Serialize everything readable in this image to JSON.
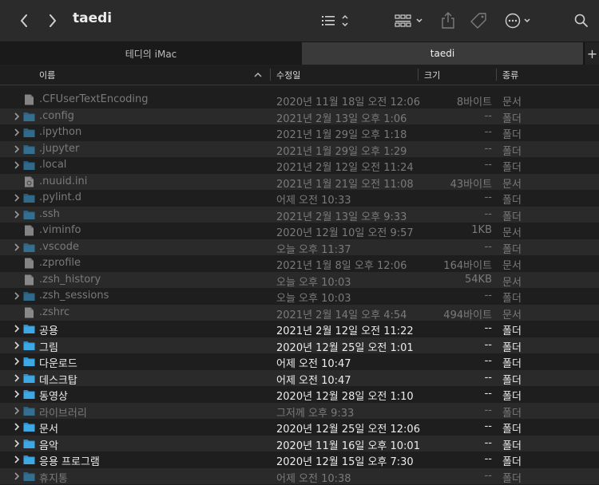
{
  "window": {
    "title": "taedi"
  },
  "toolbar": {
    "back_icon": "chevron-left",
    "forward_icon": "chevron-right",
    "view_icon": "list-view",
    "group_icon": "grid-group",
    "share_icon": "share",
    "tag_icon": "tag",
    "action_icon": "ellipsis-circle",
    "search_icon": "magnifier"
  },
  "tabs": [
    {
      "label": "테디의 iMac"
    },
    {
      "label": "taedi"
    }
  ],
  "tab_add_label": "+",
  "columns": {
    "name": "이름",
    "date": "수정일",
    "size": "크기",
    "kind": "종류"
  },
  "colors": {
    "folder": "#3ea8e5",
    "dim_text": "#7a7a7a",
    "bright_text": "#ececec"
  },
  "files": [
    {
      "name": ".CFUserTextEncoding",
      "date": "2020년 11월 18일 오전 12:06",
      "size": "8바이트",
      "kind": "문서",
      "type": "doc",
      "dim": true,
      "expandable": false
    },
    {
      "name": ".config",
      "date": "2021년 2월 13일 오후 1:06",
      "size": "--",
      "kind": "폴더",
      "type": "folder",
      "dim": true,
      "expandable": true
    },
    {
      "name": ".ipython",
      "date": "2021년 1월 29일 오후 1:18",
      "size": "--",
      "kind": "폴더",
      "type": "folder",
      "dim": true,
      "expandable": true
    },
    {
      "name": ".jupyter",
      "date": "2021년 1월 29일 오후 1:29",
      "size": "--",
      "kind": "폴더",
      "type": "folder",
      "dim": true,
      "expandable": true
    },
    {
      "name": ".local",
      "date": "2021년 2월 12일 오전 11:24",
      "size": "--",
      "kind": "폴더",
      "type": "folder",
      "dim": true,
      "expandable": true
    },
    {
      "name": ".nuuid.ini",
      "date": "2021년 1월 21일 오전 11:08",
      "size": "43바이트",
      "kind": "문서",
      "type": "gear-doc",
      "dim": true,
      "expandable": false
    },
    {
      "name": ".pylint.d",
      "date": "어제 오전 10:33",
      "size": "--",
      "kind": "폴더",
      "type": "folder",
      "dim": true,
      "expandable": true
    },
    {
      "name": ".ssh",
      "date": "2021년 2월 13일 오후 9:33",
      "size": "--",
      "kind": "폴더",
      "type": "folder",
      "dim": true,
      "expandable": true
    },
    {
      "name": ".viminfo",
      "date": "2020년 12월 10일 오전 9:57",
      "size": "1KB",
      "kind": "문서",
      "type": "doc",
      "dim": true,
      "expandable": false
    },
    {
      "name": ".vscode",
      "date": "오늘 오후 11:37",
      "size": "--",
      "kind": "폴더",
      "type": "folder",
      "dim": true,
      "expandable": true
    },
    {
      "name": ".zprofile",
      "date": "2021년 1월 8일 오후 12:06",
      "size": "164바이트",
      "kind": "문서",
      "type": "doc",
      "dim": true,
      "expandable": false
    },
    {
      "name": ".zsh_history",
      "date": "오늘 오후 10:03",
      "size": "54KB",
      "kind": "문서",
      "type": "doc",
      "dim": true,
      "expandable": false
    },
    {
      "name": ".zsh_sessions",
      "date": "오늘 오후 10:03",
      "size": "--",
      "kind": "폴더",
      "type": "folder",
      "dim": true,
      "expandable": true
    },
    {
      "name": ".zshrc",
      "date": "2021년 2월 14일 오후 4:54",
      "size": "494바이트",
      "kind": "문서",
      "type": "doc",
      "dim": true,
      "expandable": false
    },
    {
      "name": "공용",
      "date": "2021년 2월 12일 오전 11:22",
      "size": "--",
      "kind": "폴더",
      "type": "folder",
      "dim": false,
      "expandable": true
    },
    {
      "name": "그림",
      "date": "2020년 12월 25일 오전 1:01",
      "size": "--",
      "kind": "폴더",
      "type": "folder",
      "dim": false,
      "expandable": true
    },
    {
      "name": "다운로드",
      "date": "어제 오전 10:47",
      "size": "--",
      "kind": "폴더",
      "type": "folder",
      "dim": false,
      "expandable": true
    },
    {
      "name": "데스크탑",
      "date": "어제 오전 10:47",
      "size": "--",
      "kind": "폴더",
      "type": "folder",
      "dim": false,
      "expandable": true
    },
    {
      "name": "동영상",
      "date": "2020년 12월 28일 오전 1:10",
      "size": "--",
      "kind": "폴더",
      "type": "folder",
      "dim": false,
      "expandable": true
    },
    {
      "name": "라이브러리",
      "date": "그저께 오후 9:33",
      "size": "--",
      "kind": "폴더",
      "type": "folder",
      "dim": true,
      "expandable": true
    },
    {
      "name": "문서",
      "date": "2020년 12월 25일 오전 12:06",
      "size": "--",
      "kind": "폴더",
      "type": "folder",
      "dim": false,
      "expandable": true
    },
    {
      "name": "음악",
      "date": "2020년 11월 16일 오후 10:01",
      "size": "--",
      "kind": "폴더",
      "type": "folder",
      "dim": false,
      "expandable": true
    },
    {
      "name": "응용 프로그램",
      "date": "2020년 12월 15일 오후 7:30",
      "size": "--",
      "kind": "폴더",
      "type": "folder",
      "dim": false,
      "expandable": true
    },
    {
      "name": "휴지통",
      "date": "어제 오전 10:38",
      "size": "--",
      "kind": "폴더",
      "type": "folder",
      "dim": true,
      "expandable": true
    }
  ]
}
